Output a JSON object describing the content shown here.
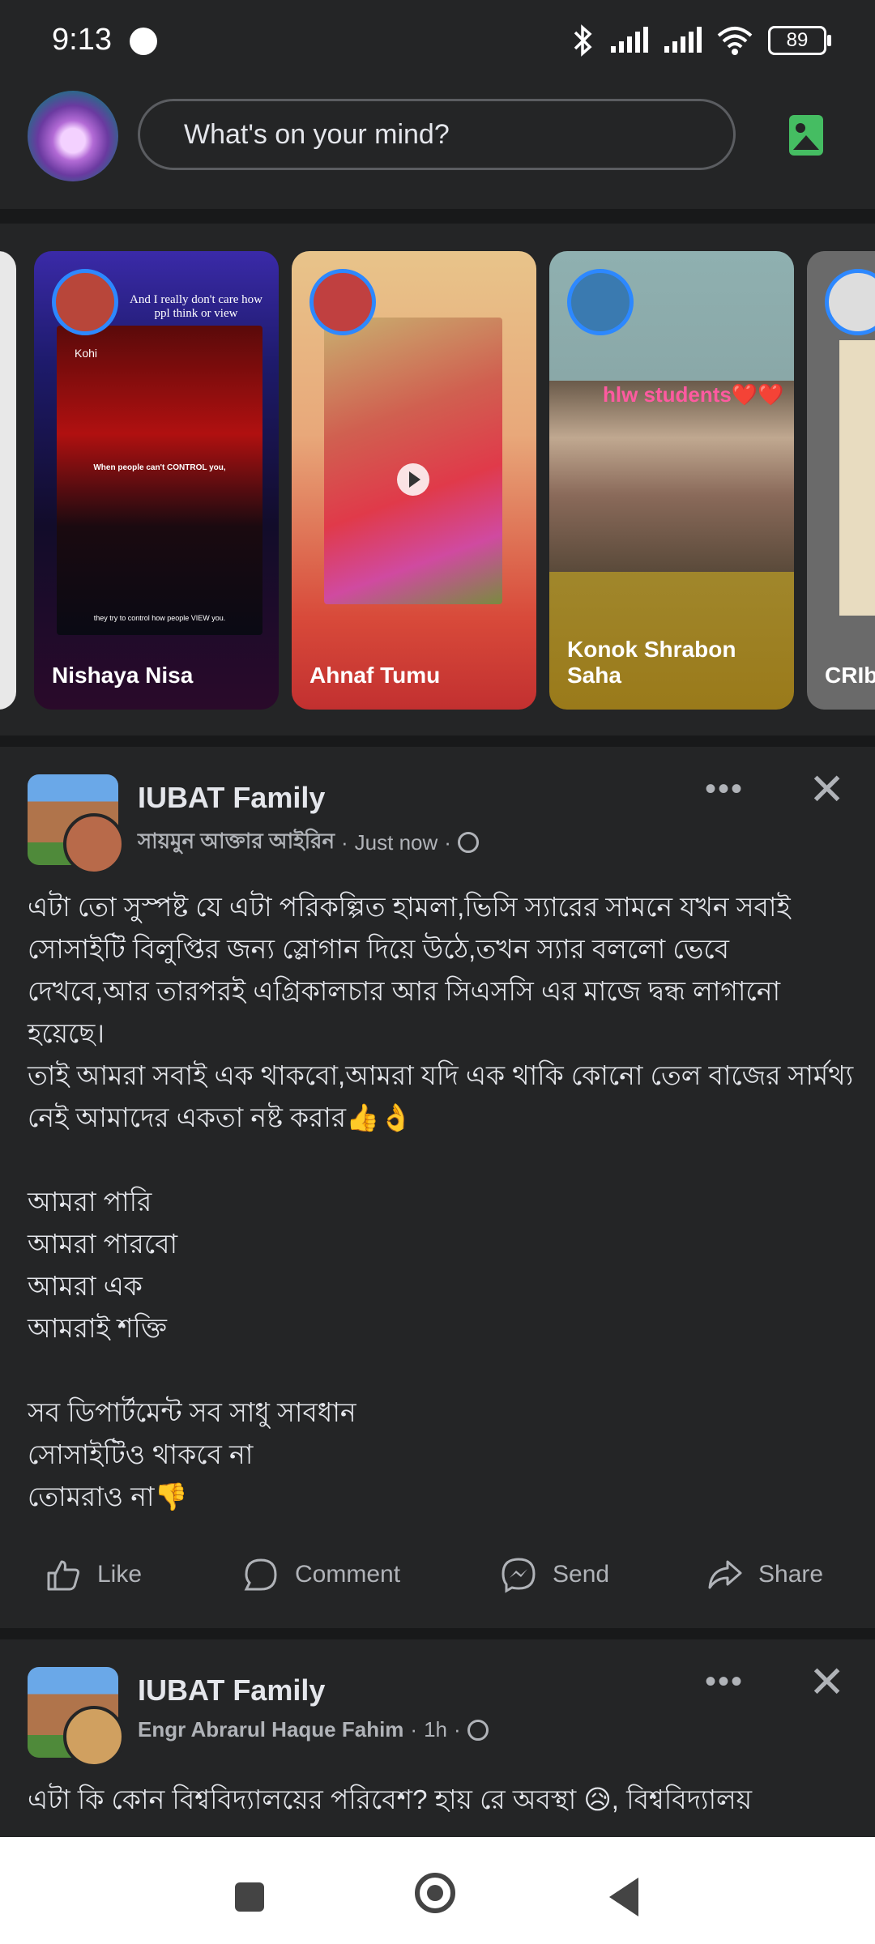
{
  "status_bar": {
    "time": "9:13",
    "battery": "89"
  },
  "composer": {
    "placeholder": "What's on your mind?"
  },
  "stories": [
    {
      "name": "Nishaya Nisa",
      "top_text": "And I really don't care how ppl think or view",
      "tag": "Kohi",
      "mid_text": "When people can't CONTROL you,",
      "bottom_text": "they try to control how people VIEW you."
    },
    {
      "name": "Ahnaf Tumu"
    },
    {
      "name": "Konok Shrabon Saha",
      "overlay": "hlw students❤️❤️"
    },
    {
      "name": "CRIba"
    }
  ],
  "posts": [
    {
      "group": "IUBAT Family",
      "author": "সায়মুন আক্তার আইরিন",
      "time": "Just now",
      "body": "এটা তো সুস্পষ্ট যে এটা পরিকল্পিত হামলা,ভিসি স্যারের সামনে যখন সবাই সোসাইটি বিলুপ্তির জন্য স্লোগান দিয়ে উঠে,তখন স্যার বললো ভেবে দেখবে,আর তারপরই এগ্রিকালচার আর সিএসসি এর মাজে দ্বন্ধ লাগানো হয়েছে।\nতাই আমরা সবাই এক থাকবো,আমরা যদি এক থাকি কোনো তেল বাজের সার্মথ্য নেই আমাদের একতা নষ্ট করার👍👌\n\nআমরা পারি\nআমরা পারবো\nআমরা এক\nআমরাই শক্তি\n\nসব ডিপার্টমেন্ট সব সাধু সাবধান\nসোসাইটিও থাকবে না\nতোমরাও না👎"
    },
    {
      "group": "IUBAT Family",
      "author": "Engr Abrarul Haque Fahim",
      "time": "1h",
      "body": "এটা কি কোন বিশ্ববিদ্যালয়ের পরিবেশ? হায় রে অবস্থা 😥, বিশ্ববিদ্যালয়"
    }
  ],
  "actions": {
    "like": "Like",
    "comment": "Comment",
    "send": "Send",
    "share": "Share"
  },
  "more": "•••",
  "close": "✕",
  "dot": "·"
}
